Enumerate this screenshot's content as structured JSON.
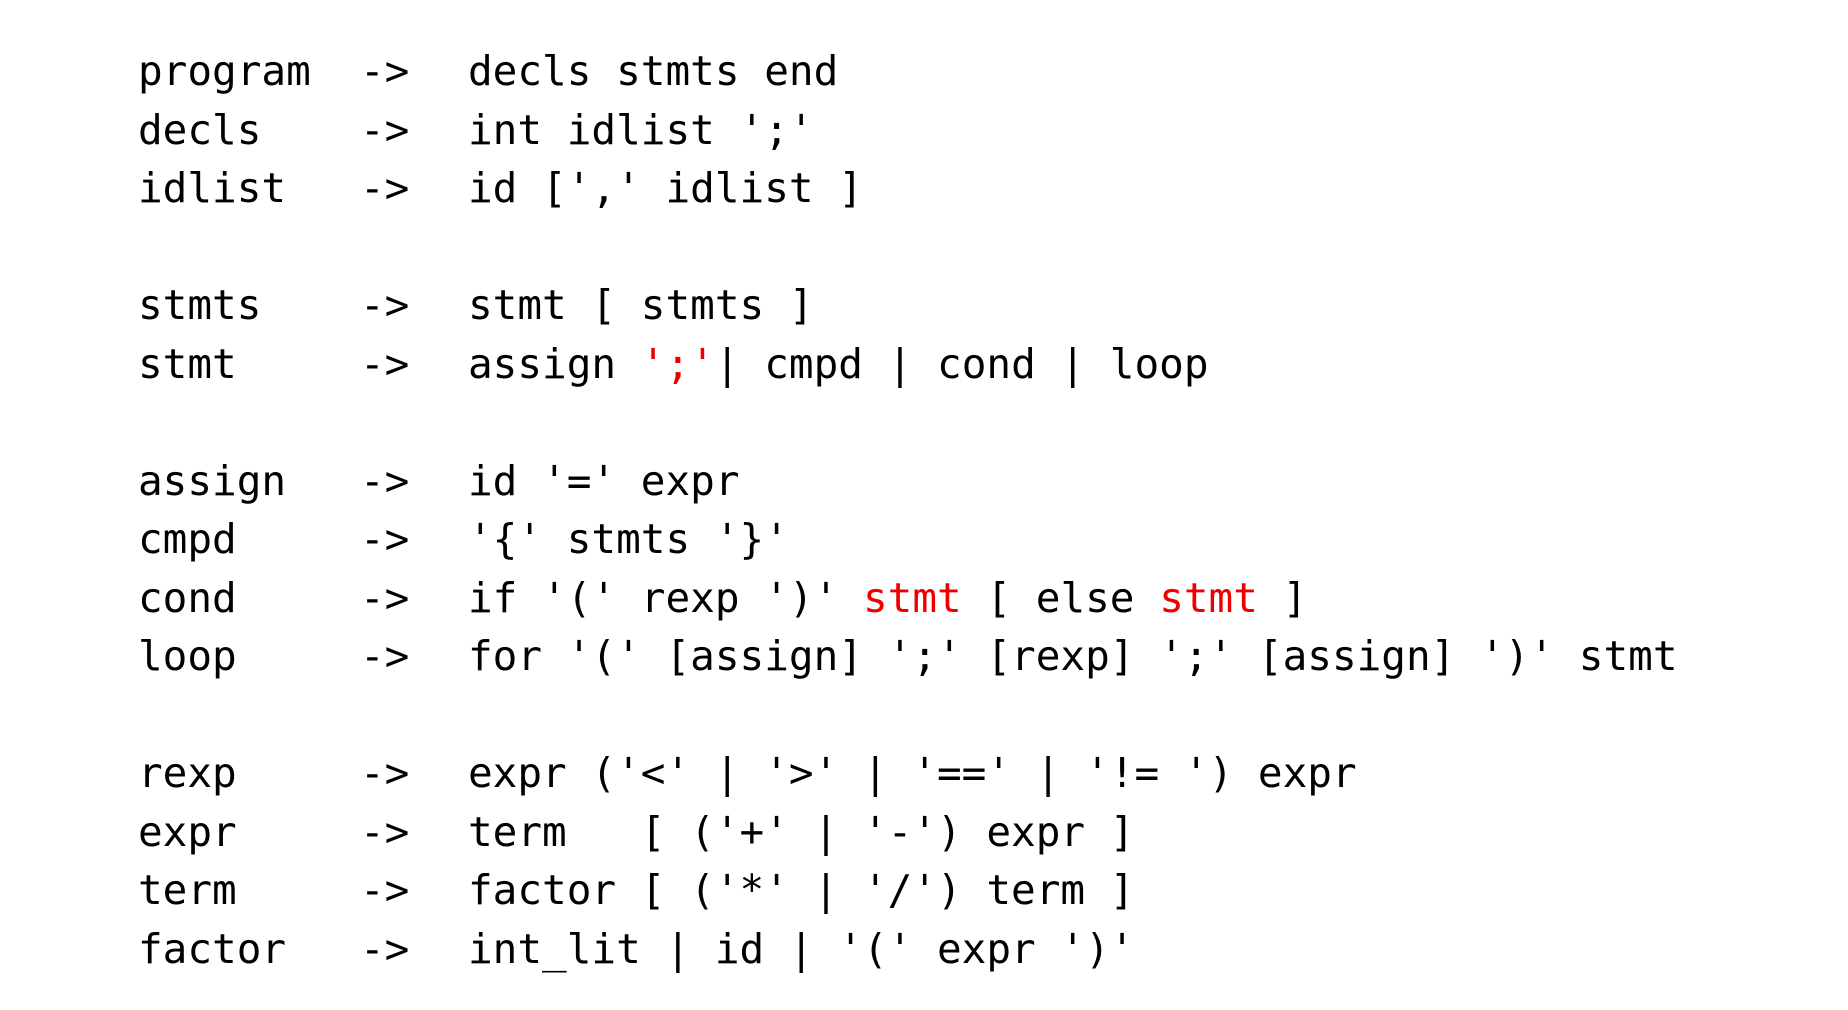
{
  "highlight_color": "#ee0000",
  "groups": [
    {
      "rules": [
        {
          "lhs": "program",
          "arrow": "->",
          "rhs": [
            {
              "t": "decls stmts end"
            }
          ]
        },
        {
          "lhs": "decls",
          "arrow": "->",
          "rhs": [
            {
              "t": "int idlist ';'"
            }
          ]
        },
        {
          "lhs": "idlist",
          "arrow": "->",
          "rhs": [
            {
              "t": "id [',' idlist ]"
            }
          ]
        }
      ]
    },
    {
      "rules": [
        {
          "lhs": "stmts",
          "arrow": "->",
          "rhs": [
            {
              "t": "stmt [ stmts ]"
            }
          ]
        },
        {
          "lhs": "stmt",
          "arrow": "->",
          "rhs": [
            {
              "t": "assign "
            },
            {
              "t": "';'",
              "hl": true
            },
            {
              "t": "| cmpd | cond | loop"
            }
          ]
        }
      ]
    },
    {
      "rules": [
        {
          "lhs": "assign",
          "arrow": "->",
          "rhs": [
            {
              "t": "id '=' expr"
            }
          ]
        },
        {
          "lhs": "cmpd",
          "arrow": "->",
          "rhs": [
            {
              "t": "'{' stmts '}'"
            }
          ]
        },
        {
          "lhs": "cond",
          "arrow": "->",
          "rhs": [
            {
              "t": "if '(' rexp ')' "
            },
            {
              "t": "stmt",
              "hl": true
            },
            {
              "t": " [ else "
            },
            {
              "t": "stmt",
              "hl": true
            },
            {
              "t": " ]"
            }
          ]
        },
        {
          "lhs": "loop",
          "arrow": "->",
          "rhs": [
            {
              "t": "for '(' [assign] ';' [rexp] ';' [assign] ')' stmt"
            }
          ]
        }
      ]
    },
    {
      "rules": [
        {
          "lhs": "rexp",
          "arrow": "->",
          "rhs": [
            {
              "t": "expr ('<' | '>' | '==' | '!= ') expr"
            }
          ]
        },
        {
          "lhs": "expr",
          "arrow": "->",
          "rhs": [
            {
              "t": "term   [ ('+' | '-') expr ]"
            }
          ]
        },
        {
          "lhs": "term",
          "arrow": "->",
          "rhs": [
            {
              "t": "factor [ ('*' | '/') term ]"
            }
          ]
        },
        {
          "lhs": "factor",
          "arrow": "->",
          "rhs": [
            {
              "t": "int_lit | id | '(' expr ')'"
            }
          ]
        }
      ]
    }
  ]
}
